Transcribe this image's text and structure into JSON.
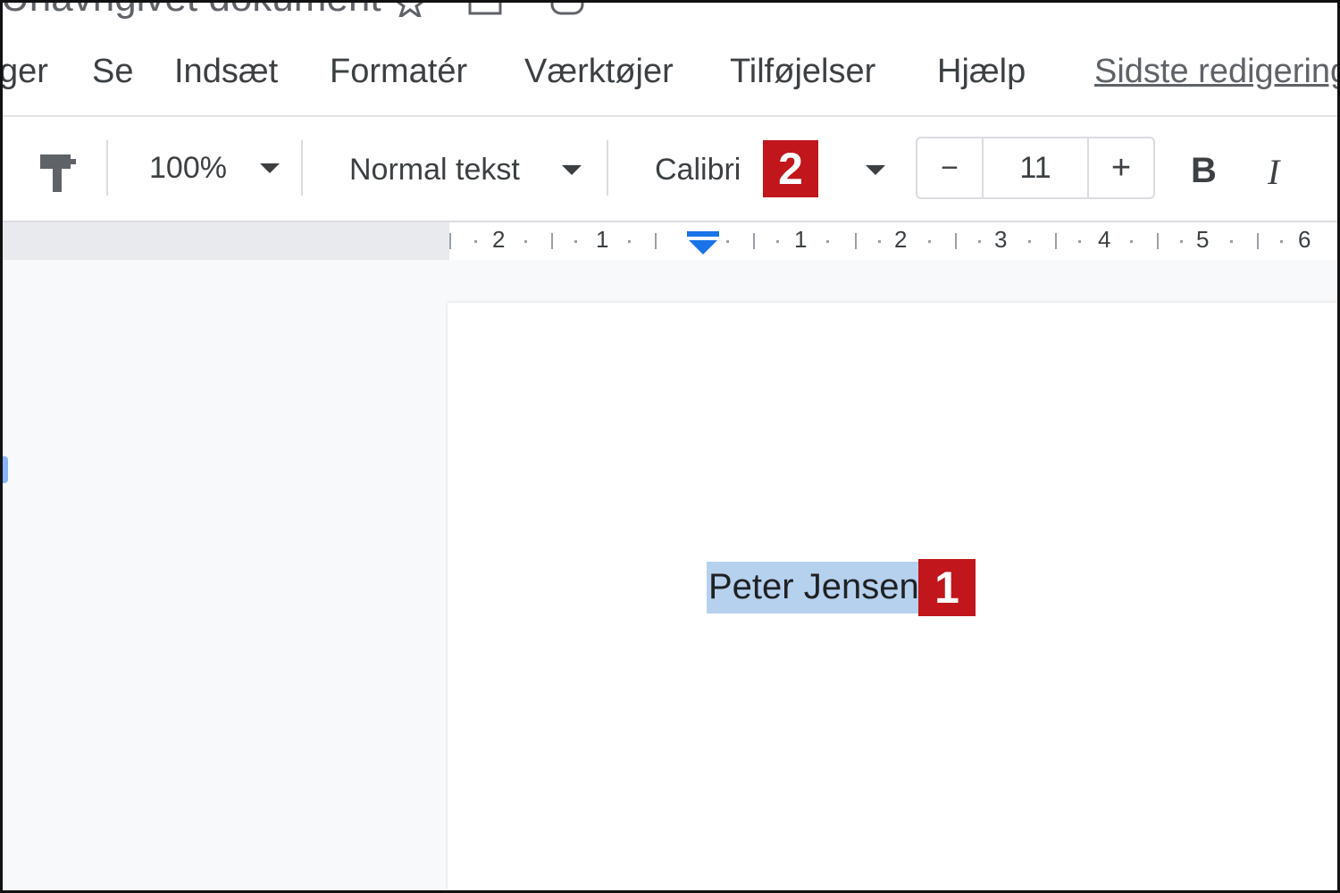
{
  "document": {
    "title": "Unavngivet dokument"
  },
  "menu": {
    "items": [
      {
        "id": "filer",
        "label": "ger"
      },
      {
        "id": "se",
        "label": "Se"
      },
      {
        "id": "indsaet",
        "label": "Indsæt"
      },
      {
        "id": "formater",
        "label": "Formatér"
      },
      {
        "id": "vaerktojer",
        "label": "Værktøjer"
      },
      {
        "id": "tilfojelser",
        "label": "Tilføjelser"
      },
      {
        "id": "hjaelp",
        "label": "Hjælp"
      }
    ],
    "last_edit": "Sidste redigering"
  },
  "toolbar": {
    "zoom": "100%",
    "style": "Normal tekst",
    "font": "Calibri",
    "font_size": "11",
    "decrease_label": "−",
    "increase_label": "+",
    "bold_label": "B",
    "italic_label": "I"
  },
  "ruler": {
    "labels": [
      "2",
      "1",
      "1",
      "2",
      "3",
      "4",
      "5",
      "6"
    ]
  },
  "page": {
    "selected_text": "Peter Jensen"
  },
  "annotations": {
    "marker_1": "1",
    "marker_2": "2"
  },
  "colors": {
    "selection": "#b6d1ee",
    "badge": "#c0161c",
    "indent_marker": "#1a73e8"
  },
  "icons": {
    "paint_format": "paint-format-icon",
    "star": "star-icon",
    "move": "folder-icon",
    "cloud": "cloud-icon"
  }
}
